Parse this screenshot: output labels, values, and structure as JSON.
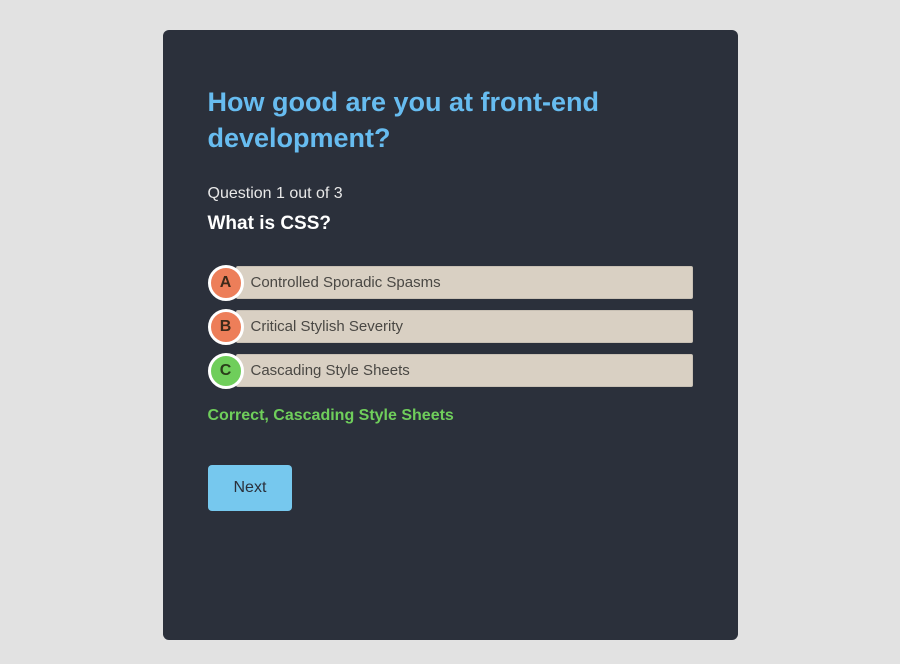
{
  "quiz": {
    "title": "How good are you at front-end development?",
    "progress": "Question 1 out of 3",
    "question": "What is CSS?",
    "answers": [
      {
        "letter": "A",
        "text": "Controlled Sporadic Spasms",
        "correct": false
      },
      {
        "letter": "B",
        "text": "Critical Stylish Severity",
        "correct": false
      },
      {
        "letter": "C",
        "text": "Cascading Style Sheets",
        "correct": true
      }
    ],
    "feedback": "Correct, Cascading Style Sheets",
    "next_label": "Next"
  }
}
